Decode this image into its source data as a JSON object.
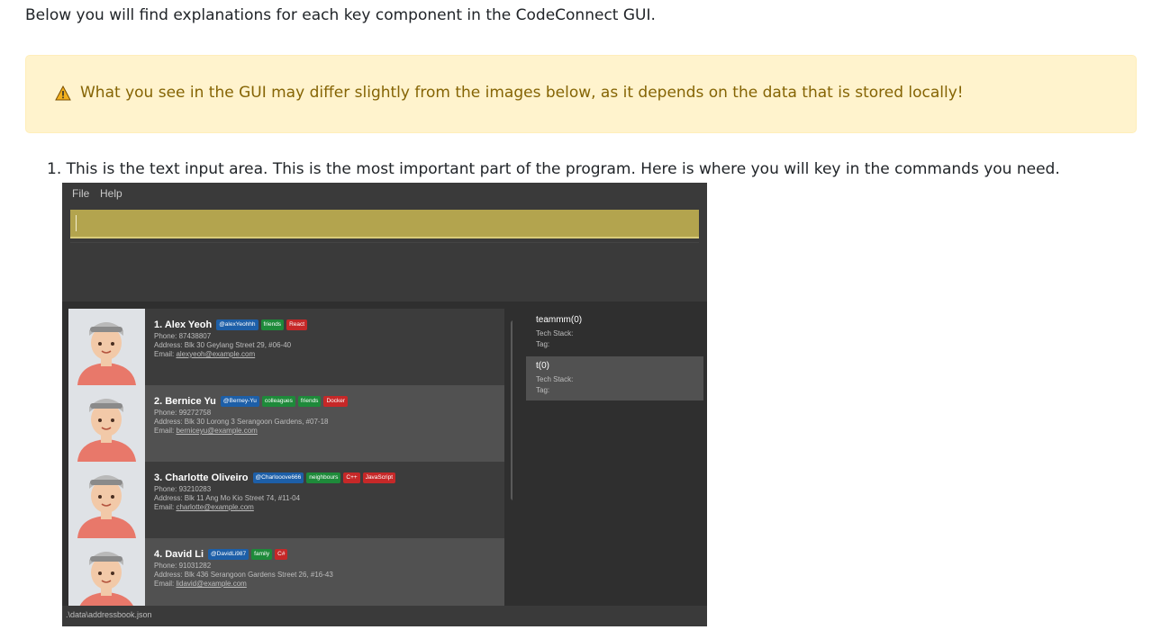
{
  "intro": "Below you will find explanations for each key component in the CodeConnect GUI.",
  "warning": {
    "icon": "warning-icon",
    "text": "What you see in the GUI may differ slightly from the images below, as it depends on the data that is stored locally!"
  },
  "step": "1. This is the text input area. This is the most important part of the program. Here is where you will key in the commands you need.",
  "app": {
    "menu": [
      "File",
      "Help"
    ],
    "persons": [
      {
        "name": "1.  Alex Yeoh",
        "github": "@alexYeohhh",
        "tags": [
          "friends"
        ],
        "tech": [
          "React"
        ],
        "phone": "Phone: 87438807",
        "address": "Address: Blk 30 Geylang Street 29, #06-40",
        "email_label": "Email: ",
        "email": "alexyeoh@example.com"
      },
      {
        "name": "2.  Bernice Yu",
        "github": "@Berney-Yu",
        "tags": [
          "colleagues",
          "friends"
        ],
        "tech": [
          "Docker"
        ],
        "phone": "Phone: 99272758",
        "address": "Address: Blk 30 Lorong 3 Serangoon Gardens, #07-18",
        "email_label": "Email: ",
        "email": "berniceyu@example.com"
      },
      {
        "name": "3.  Charlotte Oliveiro",
        "github": "@Charlooove666",
        "tags": [
          "neighbours"
        ],
        "tech": [
          "C++",
          "JavaScript"
        ],
        "phone": "Phone: 93210283",
        "address": "Address: Blk 11 Ang Mo Kio Street 74, #11-04",
        "email_label": "Email: ",
        "email": "charlotte@example.com"
      },
      {
        "name": "4.  David Li",
        "github": "@DavidLi987",
        "tags": [
          "family"
        ],
        "tech": [
          "C#"
        ],
        "phone": "Phone: 91031282",
        "address": "Address: Blk 436 Serangoon Gardens Street 26, #16-43",
        "email_label": "Email: ",
        "email": "lidavid@example.com"
      }
    ],
    "teams": [
      {
        "name": "teammm(0)",
        "tech": "Tech Stack:",
        "tag": "Tag:"
      },
      {
        "name": "t(0)",
        "tech": "Tech Stack:",
        "tag": "Tag:"
      }
    ],
    "status": ".\\data\\addressbook.json"
  },
  "colors": {
    "warning_bg": "#fff3cd",
    "warning_text": "#856404",
    "command_box": "#b3a44e",
    "github_tag": "#1d5fa8",
    "group_tag": "#1e8a3a",
    "tech_tag": "#c62828"
  }
}
